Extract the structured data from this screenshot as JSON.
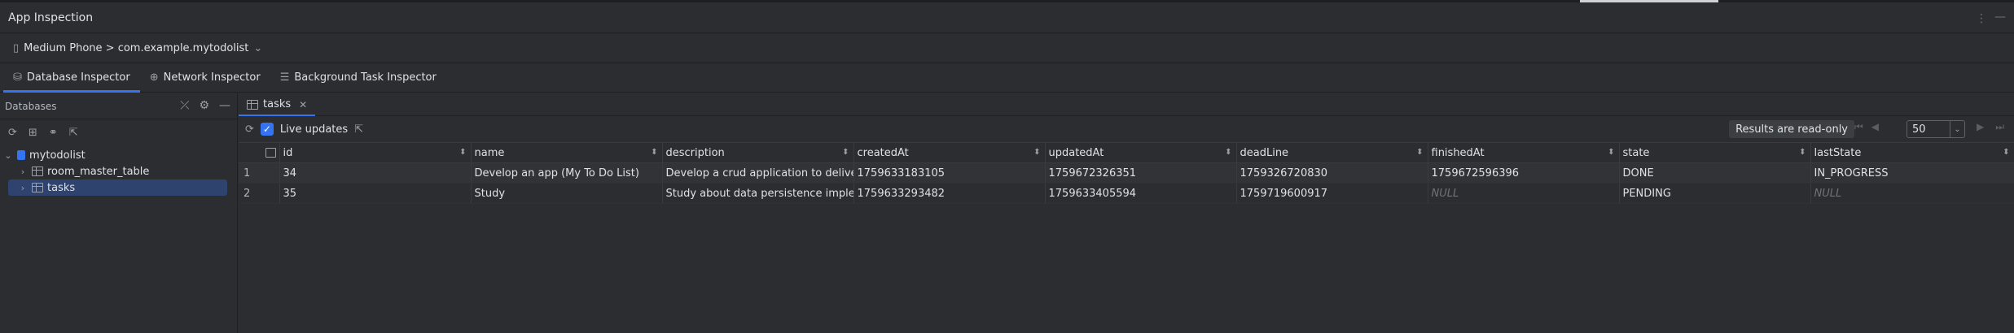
{
  "window": {
    "title": "App Inspection"
  },
  "device": {
    "label": "Medium Phone > com.example.mytodolist"
  },
  "tabs": [
    {
      "label": "Database Inspector"
    },
    {
      "label": "Network Inspector"
    },
    {
      "label": "Background Task Inspector"
    }
  ],
  "databases": {
    "header": "Databases",
    "tree": {
      "db": "mytodolist",
      "tables": [
        "room_master_table",
        "tasks"
      ]
    }
  },
  "main": {
    "tab_label": "tasks",
    "live_updates_label": "Live updates",
    "read_only_label": "Results are read-only",
    "page_size": "50",
    "columns": [
      "id",
      "name",
      "description",
      "createdAt",
      "updatedAt",
      "deadLine",
      "finishedAt",
      "state",
      "lastState"
    ],
    "rows": [
      {
        "index": "1",
        "cells": [
          "34",
          "Develop an app (My To Do List)",
          "Develop a crud application to deliver",
          "1759633183105",
          "1759672326351",
          "1759326720830",
          "1759672596396",
          "DONE",
          "IN_PROGRESS"
        ]
      },
      {
        "index": "2",
        "cells": [
          "35",
          "Study",
          "Study about data persistence implen",
          "1759633293482",
          "1759633405594",
          "1759719600917",
          "NULL",
          "PENDING",
          "NULL"
        ]
      }
    ]
  },
  "colors": {
    "accent": "#3574f0",
    "background": "#2b2d30",
    "selection": "#2e436e"
  }
}
